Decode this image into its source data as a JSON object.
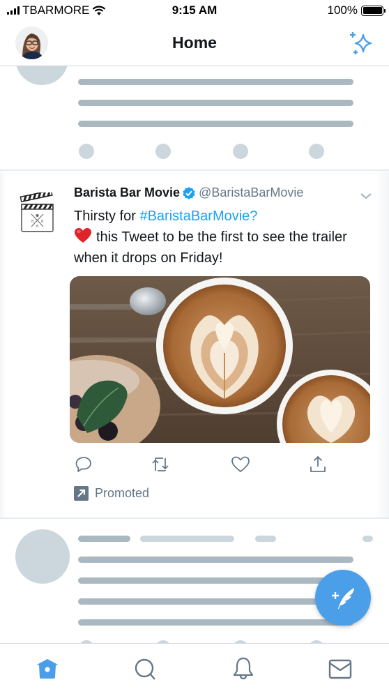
{
  "status_bar": {
    "carrier": "TBARMORE",
    "time": "9:15 AM",
    "battery_percent": "100%",
    "battery_level": 1.0,
    "signal_bars": 4,
    "icons": [
      "signal-icon",
      "wifi-icon",
      "battery-icon"
    ]
  },
  "header": {
    "title": "Home",
    "avatar": "user-avatar",
    "right_icon": "sparkle-icon"
  },
  "tweet": {
    "author_name": "Barista Bar Movie",
    "verified": true,
    "handle": "@BaristaBarMovie",
    "text_prefix": "Thirsty for ",
    "hashtag": "#BaristaBarMovie?",
    "line2": "this Tweet to be the first to see the trailer when it drops on Friday!",
    "emoji": "red-heart",
    "media_alt": "Two lattes with heart latte art next to a pastry with mint and berries",
    "actions": [
      "reply-icon",
      "retweet-icon",
      "like-icon",
      "share-icon"
    ],
    "promoted_label": "Promoted",
    "colors": {
      "link": "#1da1f2",
      "secondary": "#657786"
    }
  },
  "tab_bar": {
    "tabs": [
      {
        "name": "home",
        "icon": "home-icon",
        "active": true
      },
      {
        "name": "search",
        "icon": "search-icon",
        "active": false
      },
      {
        "name": "notifications",
        "icon": "bell-icon",
        "active": false
      },
      {
        "name": "messages",
        "icon": "mail-icon",
        "active": false
      }
    ],
    "active_color": "#4a9fe8",
    "inactive_color": "#657786"
  },
  "fab": {
    "icon": "compose-tweet-icon",
    "color": "#4a9fe8"
  }
}
